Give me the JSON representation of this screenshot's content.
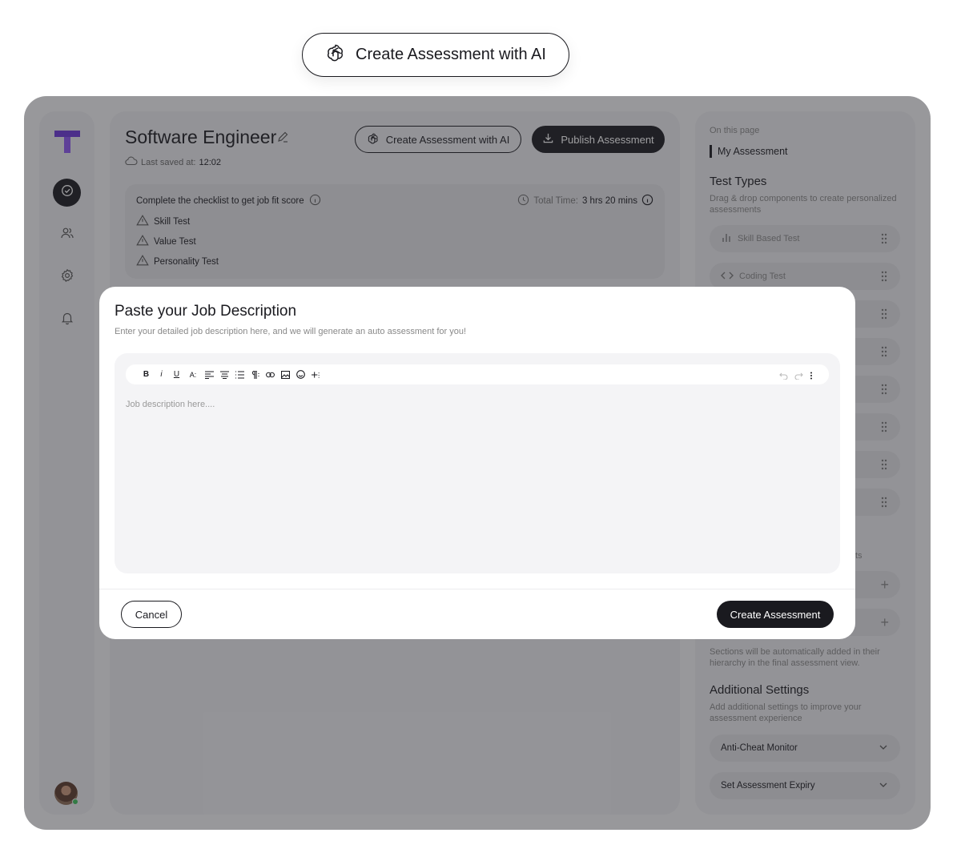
{
  "hero": {
    "label": "Create Assessment with AI",
    "icon": "openai-icon"
  },
  "sidebar": {
    "logo": "T",
    "nav": [
      {
        "name": "assessments",
        "icon": "check-circle-icon",
        "active": true
      },
      {
        "name": "candidates",
        "icon": "users-icon"
      },
      {
        "name": "settings",
        "icon": "gear-icon"
      },
      {
        "name": "notifications",
        "icon": "bell-icon"
      }
    ]
  },
  "header": {
    "title": "Software Engineer",
    "saved_label": "Last saved at:",
    "saved_time": "12:02",
    "ai_button": "Create Assessment with AI",
    "publish_button": "Publish Assessment"
  },
  "checklist": {
    "heading": "Complete the checklist to get job fit score",
    "total_time_label": "Total Time:",
    "total_time_value": "3 hrs 20 mins",
    "items": [
      "Skill Test",
      "Value Test",
      "Personality Test"
    ]
  },
  "right_panel": {
    "on_this_page": "On this page",
    "my_assessment": "My Assessment",
    "test_types_title": "Test Types",
    "test_types_desc": "Drag & drop components to create personalized assessments",
    "tests": [
      "Skill Based Test",
      "Coding Test"
    ],
    "sections_partial": "ts",
    "sections_note": "Sections will be automatically added in their hierarchy in the final assessment view.",
    "additional_title": "Additional Settings",
    "additional_desc": "Add additional settings to improve your assessment experience",
    "settings": [
      "Anti-Cheat Monitor",
      "Set Assessment Expiry"
    ]
  },
  "modal": {
    "title": "Paste your Job Description",
    "subtitle": "Enter your detailed job description here, and we will generate an auto assessment for you!",
    "placeholder": "Job description here....",
    "cancel": "Cancel",
    "create": "Create Assessment",
    "toolbar": [
      "B",
      "i",
      "U",
      "A:"
    ]
  }
}
